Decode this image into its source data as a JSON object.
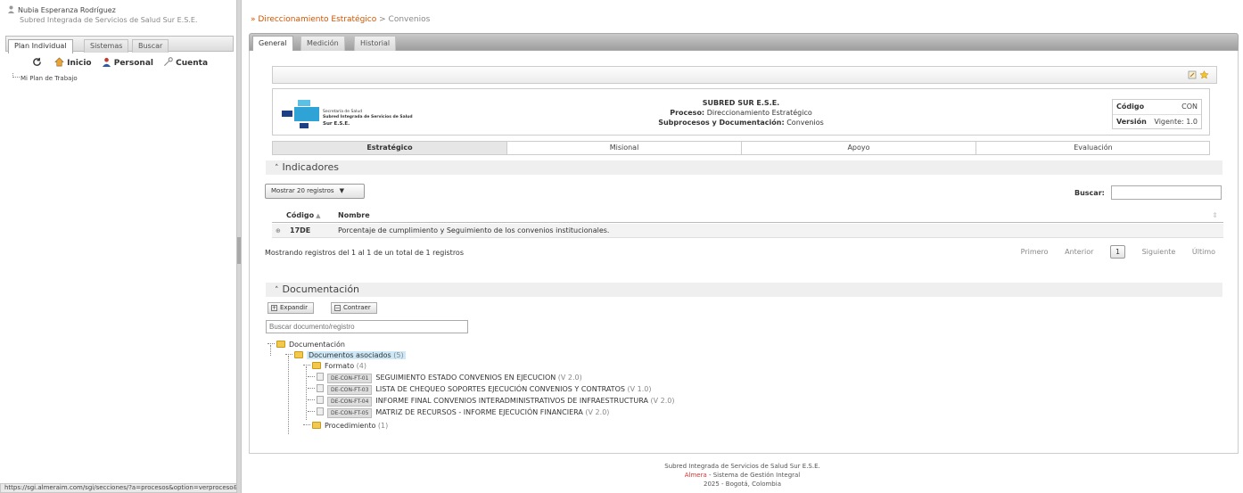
{
  "user": {
    "name": "Nubia Esperanza Rodríguez",
    "org": "Subred Integrada de Servicios de Salud Sur E.S.E."
  },
  "left_tabs": [
    "Plan Individual",
    "Sistemas",
    "Buscar"
  ],
  "left_nav": [
    "Inicio",
    "Personal",
    "Cuenta"
  ],
  "left_tree": {
    "item": "Mi Plan de Trabajo"
  },
  "status_url": "https://sgi.almeraim.com/sgi/secciones/?a=procesos&option=verproceso&procesoid=6801#",
  "breadcrumb": {
    "sep": "»",
    "parent": "Direccionamiento Estratégico",
    "arrow": ">",
    "current": "Convenios"
  },
  "tabs": [
    "General",
    "Medición",
    "Historial"
  ],
  "header": {
    "logo_line1": "Secretaría de Salud",
    "logo_line2": "Subred Integrada de Servicios de Salud",
    "logo_line3": "Sur E.S.E.",
    "entity": "SUBRED SUR E.S.E.",
    "proceso_label": "Proceso:",
    "proceso_value": "Direccionamiento Estratégico",
    "sub_label": "Subprocesos y Documentación:",
    "sub_value": "Convenios",
    "codigo_label": "Código",
    "codigo_value": "CON",
    "version_label": "Versión",
    "version_value": "Vigente: 1.0"
  },
  "categories": [
    "Estratégico",
    "Misional",
    "Apoyo",
    "Evaluación"
  ],
  "indicadores": {
    "title": "Indicadores",
    "show_records": "Mostrar 20 registros",
    "search_label": "Buscar:",
    "col_code": "Código",
    "col_name": "Nombre",
    "rows": [
      {
        "code": "17DE",
        "name": "Porcentaje de cumplimiento y Seguimiento de los convenios institucionales."
      }
    ],
    "info": "Mostrando registros del 1 al 1 de un total de 1 registros",
    "pager": {
      "first": "Primero",
      "prev": "Anterior",
      "page": "1",
      "next": "Siguiente",
      "last": "Último"
    }
  },
  "documentacion": {
    "title": "Documentación",
    "expand": "Expandir",
    "collapse": "Contraer",
    "search_placeholder": "Buscar documento/registro",
    "root": "Documentación",
    "assoc": "Documentos asociados",
    "assoc_count": "(5)",
    "formato": "Formato",
    "formato_count": "(4)",
    "docs": [
      {
        "code": "DE-CON-FT-01",
        "name": "SEGUIMIENTO ESTADO CONVENIOS EN EJECUCION",
        "ver": "(V 2.0)"
      },
      {
        "code": "DE-CON-FT-03",
        "name": "LISTA DE CHEQUEO SOPORTES EJECUCIÓN CONVENIOS Y CONTRATOS",
        "ver": "(V 1.0)"
      },
      {
        "code": "DE-CON-FT-04",
        "name": "INFORME FINAL CONVENIOS INTERADMINISTRATIVOS DE INFRAESTRUCTURA",
        "ver": "(V 2.0)"
      },
      {
        "code": "DE-CON-FT-05",
        "name": "MATRIZ DE RECURSOS - INFORME EJECUCIÓN FINANCIERA",
        "ver": "(V 2.0)"
      }
    ],
    "procedimiento": "Procedimiento",
    "procedimiento_count": "(1)"
  },
  "footer": {
    "line1": "Subred Integrada de Servicios de Salud Sur E.S.E.",
    "brand": "Almera",
    "line2": " - Sistema de Gestión Integral",
    "line3": "2025 - Bogotá, Colombia"
  }
}
